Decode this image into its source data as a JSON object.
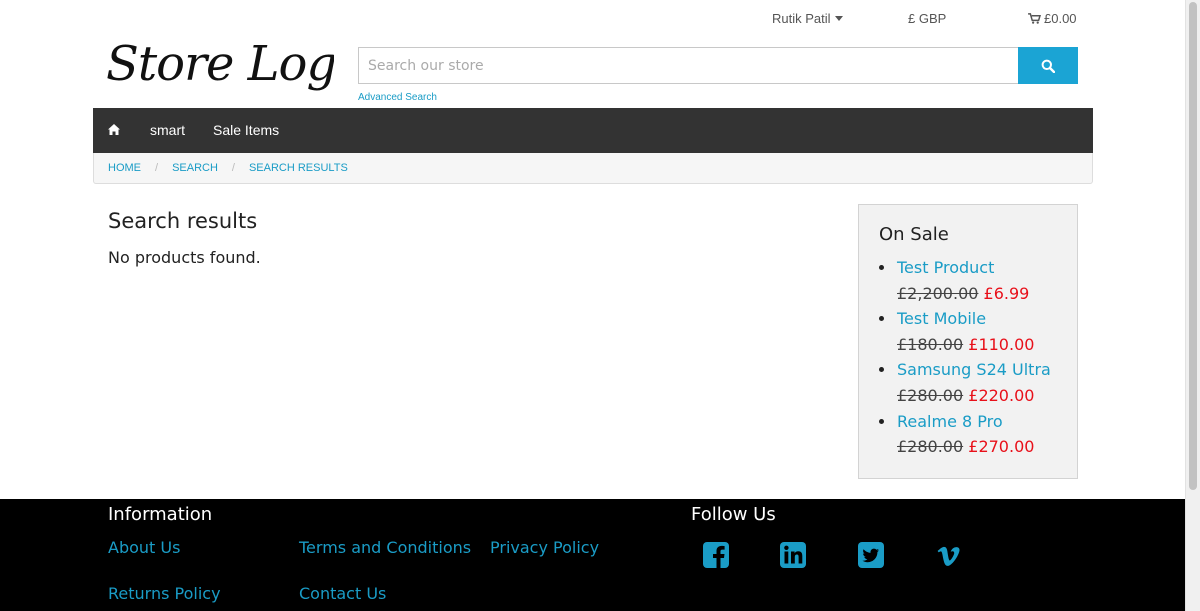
{
  "header": {
    "logo_text": "Store Logo",
    "user_name": "Rutik Patil",
    "currency": "£ GBP",
    "cart_total": "£0.00",
    "search_placeholder": "Search our store",
    "advanced_search": "Advanced Search"
  },
  "nav": {
    "items": [
      {
        "label": "smart"
      },
      {
        "label": "Sale Items"
      }
    ]
  },
  "breadcrumb": [
    "HOME",
    "SEARCH",
    "SEARCH RESULTS"
  ],
  "main": {
    "title": "Search results",
    "message": "No products found."
  },
  "sidebar": {
    "title": "On Sale",
    "products": [
      {
        "name": "Test Product",
        "old_price": "£2,200.00",
        "new_price": "£6.99"
      },
      {
        "name": "Test Mobile",
        "old_price": "£180.00",
        "new_price": "£110.00"
      },
      {
        "name": "Samsung S24 Ultra",
        "old_price": "£280.00",
        "new_price": "£220.00"
      },
      {
        "name": "Realme 8 Pro",
        "old_price": "£280.00",
        "new_price": "£270.00"
      }
    ]
  },
  "footer": {
    "info_heading": "Information",
    "links": [
      "About Us",
      "Terms and Conditions",
      "Privacy Policy",
      "Returns Policy",
      "Contact Us"
    ],
    "follow_heading": "Follow Us",
    "social_icons": [
      "facebook-icon",
      "linkedin-icon",
      "twitter-icon",
      "vimeo-icon"
    ]
  },
  "colors": {
    "accent": "#1ba4d4",
    "link": "#1a9cc6",
    "sale_price": "#e8101a",
    "nav_bg": "#333333",
    "footer_bg": "#000000"
  }
}
